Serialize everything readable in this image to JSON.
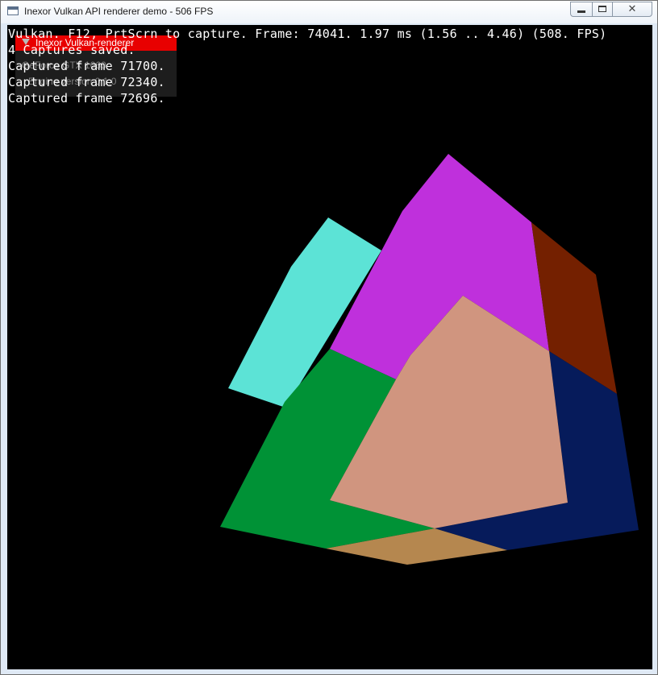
{
  "window": {
    "title": "Inexor Vulkan API renderer demo - 506 FPS",
    "close_glyph": "✕"
  },
  "imgui": {
    "title": "Inexor Vulkan-renderer",
    "gpu_line": "GeForce GTX 1060",
    "engine_line": "Engine version 0.1.0"
  },
  "console": {
    "status_line": "Vulkan. F12, PrtScrn to capture. Frame: 74041. 1.97 ms (1.56 .. 4.46) (508. FPS)",
    "captures_line": "4 Captures saved.",
    "captured_1": "Captured frame 71700.",
    "captured_2": "Captured frame 72340.",
    "captured_3": "Captured frame 72696."
  },
  "scene": {
    "background": "#000000",
    "face_colors": {
      "cyan": "#5ce3d6",
      "magenta": "#bf30dc",
      "maroon": "#742000",
      "green": "#009236",
      "navy": "#061b5b",
      "peach": "#d0957f",
      "tan": "#b5874f"
    }
  },
  "colors": {
    "imgui_titlebar": "#e80000",
    "window_frame": "#dfe9f5"
  }
}
